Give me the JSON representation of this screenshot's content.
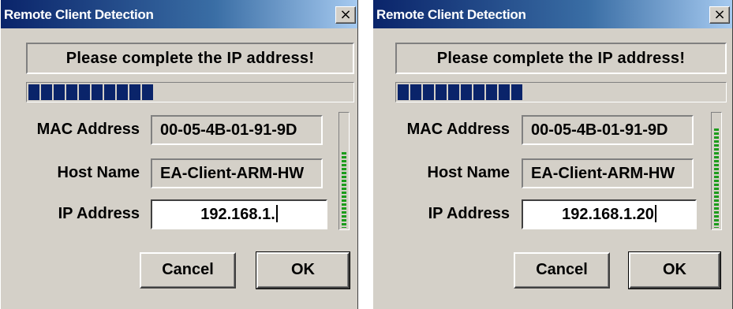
{
  "dialogs": [
    {
      "title": "Remote Client Detection",
      "close_glyph": "×",
      "status_text": "Please complete the IP address!",
      "progress_segments": 10,
      "mac_label": "MAC Address",
      "mac_value": "00-05-4B-01-91-9D",
      "host_label": "Host Name",
      "host_value": "EA-Client-ARM-HW",
      "ip_label": "IP Address",
      "ip_value": "192.168.1.",
      "signal_level": 0.65,
      "cancel_label": "Cancel",
      "ok_label": "OK"
    },
    {
      "title": "Remote Client Detection",
      "close_glyph": "×",
      "status_text": "Please complete the IP address!",
      "progress_segments": 10,
      "mac_label": "MAC Address",
      "mac_value": "00-05-4B-01-91-9D",
      "host_label": "Host Name",
      "host_value": "EA-Client-ARM-HW",
      "ip_label": "IP Address",
      "ip_value": "192.168.1.20",
      "signal_level": 0.85,
      "cancel_label": "Cancel",
      "ok_label": "OK"
    }
  ],
  "colors": {
    "titlebar_start": "#0a246a",
    "titlebar_end": "#a6caf0",
    "dialog_face": "#d4d0c8",
    "progress_segment": "#0a246a",
    "signal_meter": "#1c9c1c"
  },
  "icons": {
    "close": "close-icon"
  }
}
